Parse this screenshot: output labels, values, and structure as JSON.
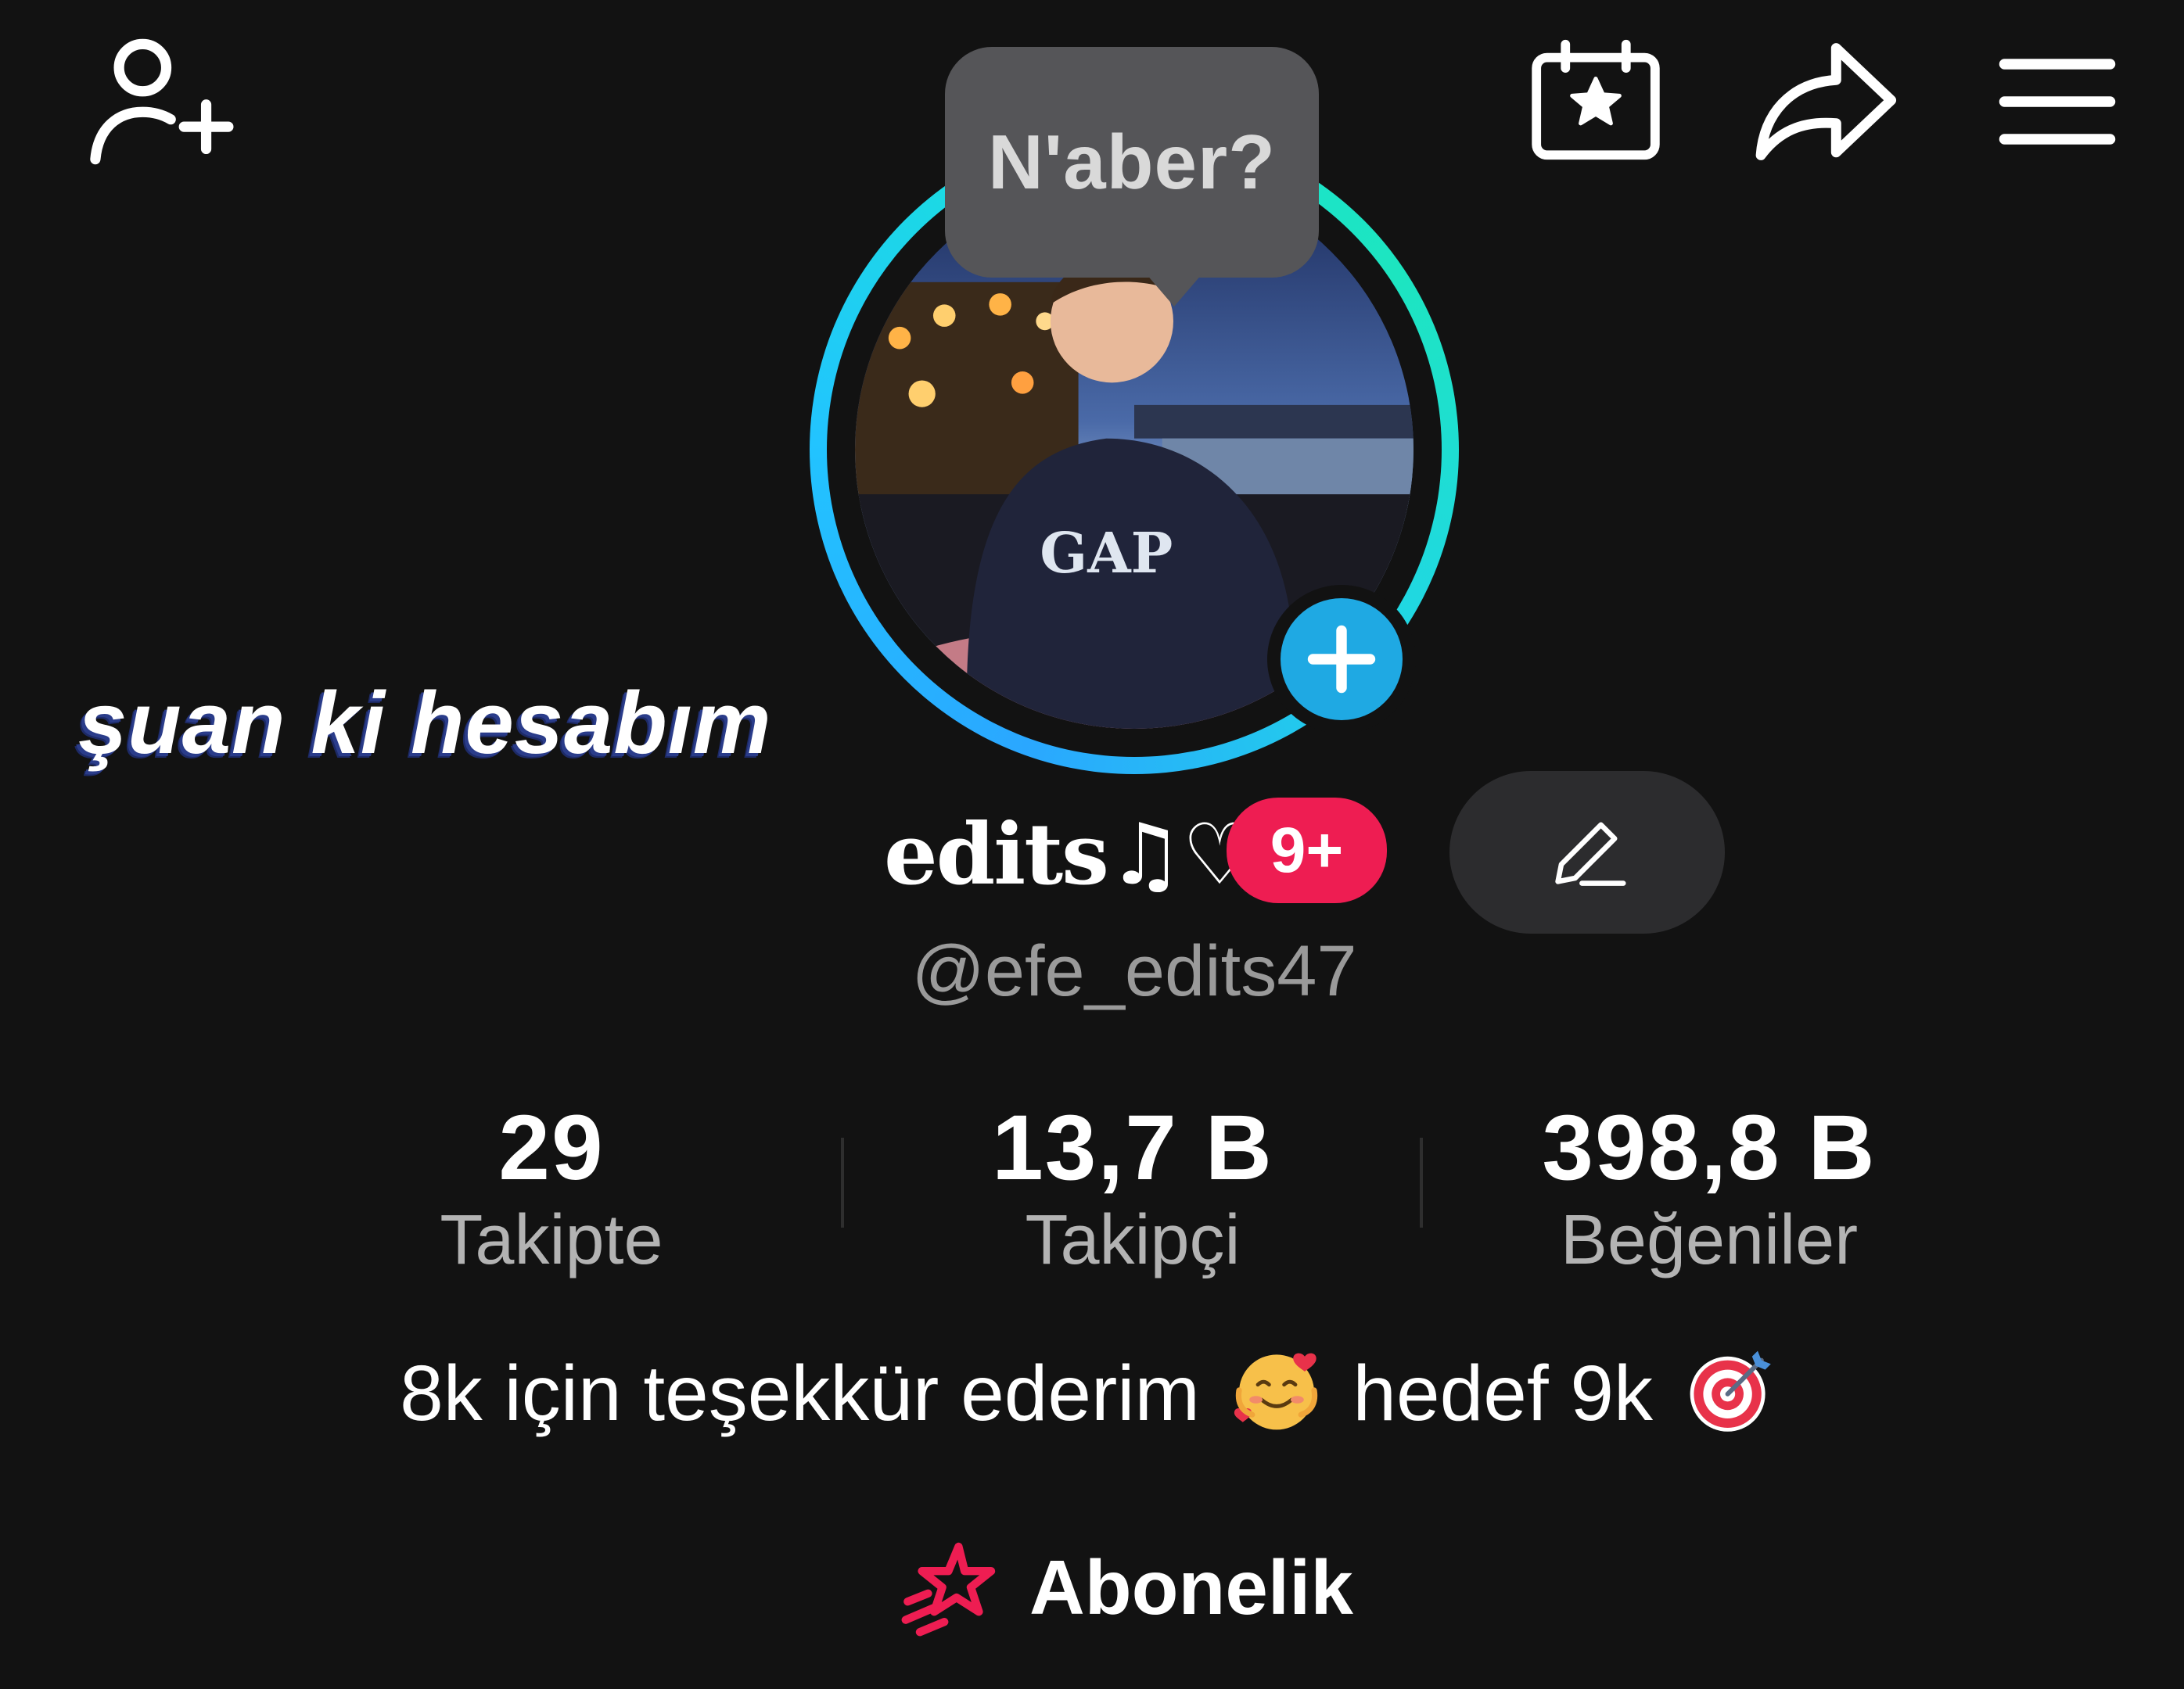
{
  "header": {
    "add_friend_icon": "person-plus-icon",
    "calendar_icon": "calendar-star-icon",
    "share_icon": "share-arrow-icon",
    "menu_icon": "hamburger-menu-icon"
  },
  "profile": {
    "status_bubble": "N'aber?",
    "display_name": "edits♫♡",
    "notification_badge": "9+",
    "username": "@efe_edits47",
    "bio": {
      "part1": "8k için teşekkür ederim",
      "emoji1": "smiling-face-with-hearts",
      "part2": "hedef 9k",
      "emoji2": "direct-hit-target"
    },
    "subscription_label": "Abonelik"
  },
  "overlay": {
    "caption": "şuan ki hesabım"
  },
  "stats": [
    {
      "value": "29",
      "label": "Takipte"
    },
    {
      "value": "13,7 B",
      "label": "Takipçi"
    },
    {
      "value": "398,8 B",
      "label": "Beğeniler"
    }
  ],
  "colors": {
    "background": "#121212",
    "badge": "#ee1d52",
    "add_story": "#1fa9e3",
    "ring_start": "#2aa7ff",
    "ring_end": "#1de5c0",
    "subscription_icon": "#ee1d52"
  }
}
